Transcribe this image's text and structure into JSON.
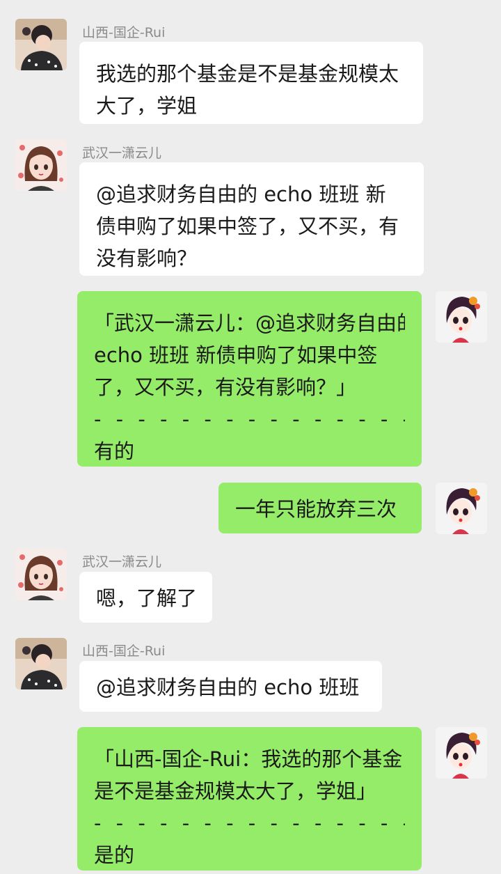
{
  "colors": {
    "background": "#ededed",
    "bubble_incoming": "#ffffff",
    "bubble_outgoing": "#95ec69",
    "sender_name": "#8a8a8a"
  },
  "messages": [
    {
      "side": "left",
      "avatar": "avatar-rui",
      "sender": "山西-国企-Rui",
      "lines": [
        "我选的那个基金是不是基金规模太",
        "大了，学姐"
      ]
    },
    {
      "side": "left",
      "avatar": "avatar-yuner",
      "sender": "武汉一潇云儿",
      "lines": [
        "@追求财务自由的 echo 班班  新",
        "债申购了如果中签了，又不买，有",
        "没有影响？"
      ]
    },
    {
      "side": "right",
      "avatar": "avatar-self",
      "lines": [
        "「武汉一潇云儿：@追求财务自由的",
        "echo 班班  新债申购了如果中签",
        "了，又不买，有没有影响？」"
      ],
      "separator": "- - - - - - - - - - - - - - -",
      "reply": "有的"
    },
    {
      "side": "right",
      "avatar": "avatar-self",
      "lines": [
        "一年只能放弃三次"
      ]
    },
    {
      "side": "left",
      "avatar": "avatar-yuner",
      "sender": "武汉一潇云儿",
      "lines": [
        "嗯，了解了"
      ]
    },
    {
      "side": "left",
      "avatar": "avatar-rui",
      "sender": "山西-国企-Rui",
      "lines": [
        "@追求财务自由的 echo 班班"
      ]
    },
    {
      "side": "right",
      "avatar": "avatar-self",
      "lines": [
        "「山西-国企-Rui：我选的那个基金",
        "是不是基金规模太大了，学姐」"
      ],
      "separator": "- - - - - - - - - - - - - - -",
      "reply": "是的"
    }
  ]
}
